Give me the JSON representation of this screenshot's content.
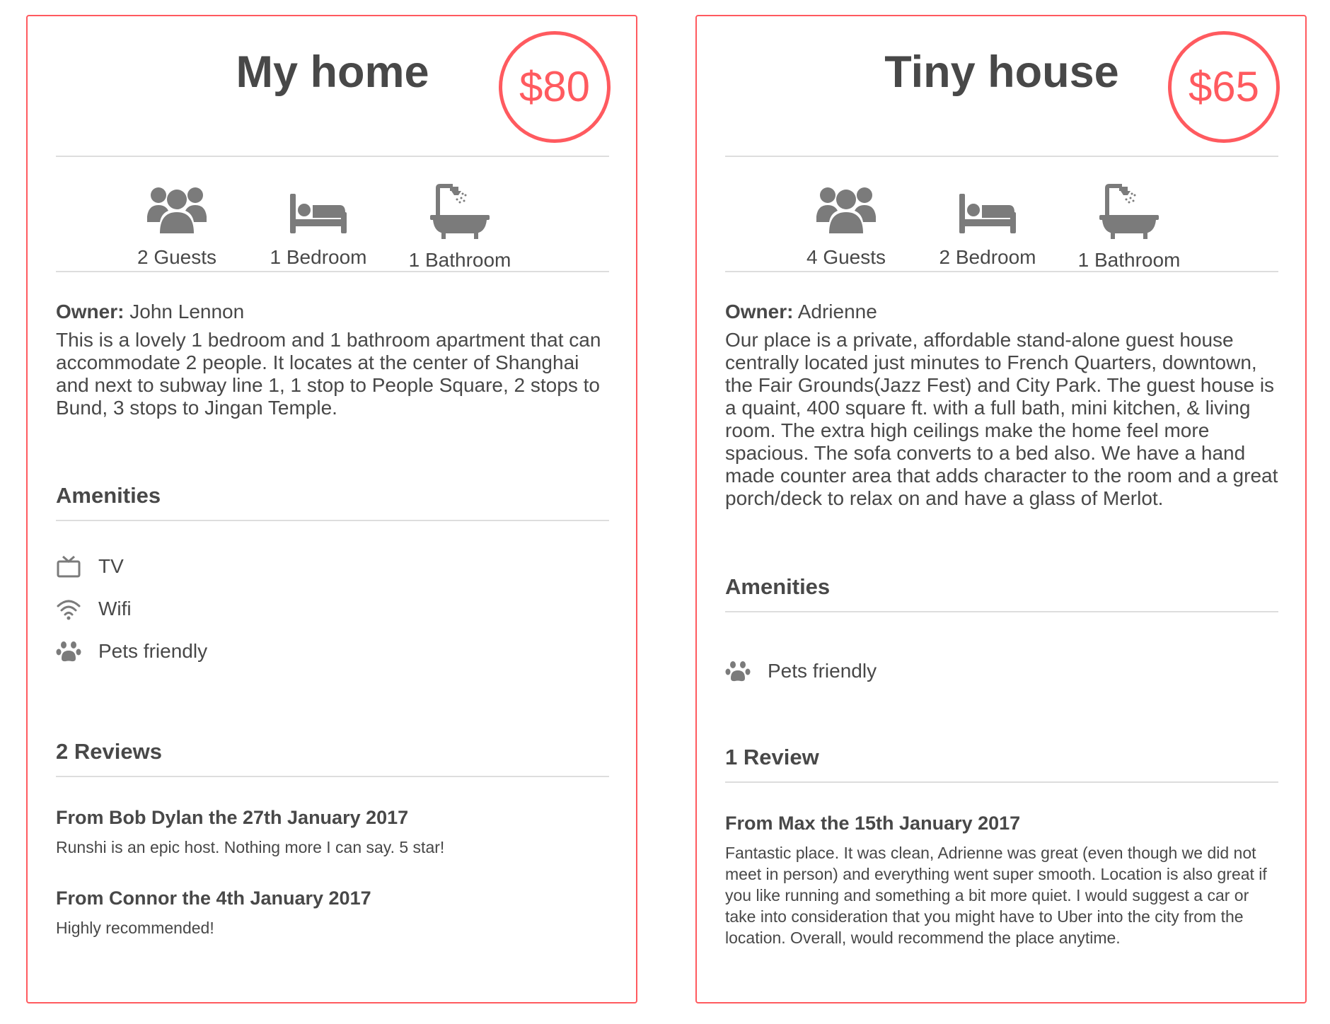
{
  "listings": [
    {
      "title": "My home",
      "price": "$80",
      "stats": [
        {
          "icon": "guests-icon",
          "label": "2 Guests"
        },
        {
          "icon": "bed-icon",
          "label": "1 Bedroom"
        },
        {
          "icon": "bathtub-icon",
          "label": "1 Bathroom"
        }
      ],
      "owner_label": "Owner:",
      "owner_name": "John Lennon",
      "description": "This is a lovely 1 bedroom and 1 bathroom apartment that can accommodate 2 people. It locates at the center of Shanghai and next to subway line 1, 1 stop to People Square, 2 stops to Bund, 3 stops to Jingan Temple.",
      "amenities_title": "Amenities",
      "amenities": [
        {
          "icon": "tv-icon",
          "label": "TV"
        },
        {
          "icon": "wifi-icon",
          "label": "Wifi"
        },
        {
          "icon": "paw-icon",
          "label": "Pets friendly"
        }
      ],
      "reviews_title": "2 Reviews",
      "reviews": [
        {
          "heading": "From Bob Dylan the 27th January 2017",
          "text": "Runshi is an epic host. Nothing more I can say. 5 star!"
        },
        {
          "heading": "From Connor the 4th January 2017",
          "text": "Highly recommended!"
        }
      ]
    },
    {
      "title": "Tiny house",
      "price": "$65",
      "stats": [
        {
          "icon": "guests-icon",
          "label": "4 Guests"
        },
        {
          "icon": "bed-icon",
          "label": "2 Bedroom"
        },
        {
          "icon": "bathtub-icon",
          "label": "1 Bathroom"
        }
      ],
      "owner_label": "Owner:",
      "owner_name": "Adrienne",
      "description": "Our place is a private, affordable stand-alone guest house centrally located just minutes to French Quarters, downtown, the Fair Grounds(Jazz Fest) and City Park. The guest house is a quaint, 400 square ft. with a full bath, mini kitchen, & living room. The extra high ceilings make the home feel more spacious. The sofa converts to a bed also. We have a hand made counter area that adds character to the room and a great porch/deck to relax on and have a glass of Merlot.",
      "amenities_title": "Amenities",
      "amenities": [
        {
          "icon": "paw-icon",
          "label": "Pets friendly"
        }
      ],
      "reviews_title": "1 Review",
      "reviews": [
        {
          "heading": "From Max the 15th January 2017",
          "text": "Fantastic place. It was clean, Adrienne was great (even though we did not meet in person) and everything went super smooth. Location is also great if you like running and something a bit more quiet. I would suggest a car or take into consideration that you might have to Uber into the city from the location. Overall, would recommend the place anytime."
        }
      ]
    }
  ],
  "colors": {
    "accent": "#ff5a5f",
    "text": "#484848",
    "icon": "#7b7b7b",
    "divider": "#dddddd"
  }
}
